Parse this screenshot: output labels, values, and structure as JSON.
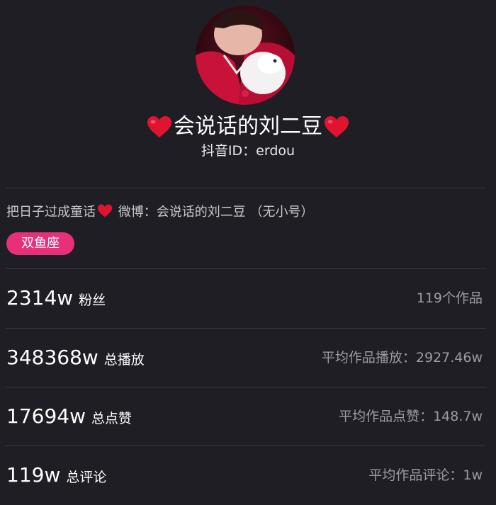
{
  "profile": {
    "name": "会说话的刘二豆",
    "douyin_id": "抖音ID：erdou",
    "avatar_icon": "avatar-photo"
  },
  "bio": {
    "text_before": "把日子过成童话",
    "text_after": " 微博：会说话的刘二豆 （无小号）"
  },
  "tag": {
    "label": "双鱼座",
    "color": "#e8307a"
  },
  "stats": [
    {
      "value": "2314w",
      "label": "粉丝",
      "right": "119个作品"
    },
    {
      "value": "348368w",
      "label": "总播放",
      "right": "平均作品播放：2927.46w"
    },
    {
      "value": "17694w",
      "label": "总点赞",
      "right": "平均作品点赞：148.7w"
    },
    {
      "value": "119w",
      "label": "总评论",
      "right": "平均作品评论：1w"
    }
  ],
  "colors": {
    "background": "#1f1e24",
    "accent": "#e8307a",
    "heart": "#e0142e",
    "muted": "#9c9ba2"
  }
}
